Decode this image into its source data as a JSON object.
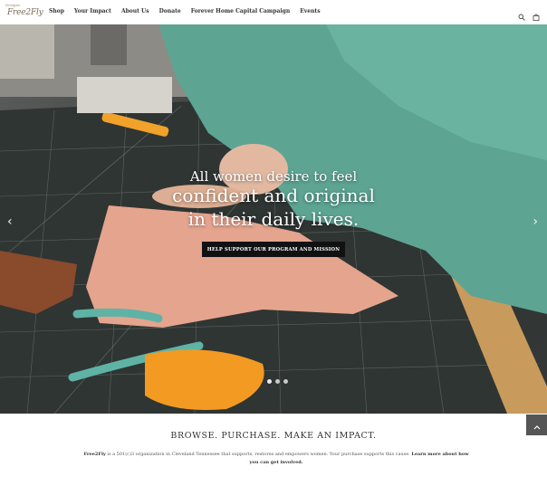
{
  "brand": {
    "tag": "Designs",
    "wordmark": "Free2Fly"
  },
  "nav": {
    "items": [
      {
        "label": "Shop"
      },
      {
        "label": "Your Impact"
      },
      {
        "label": "About Us"
      },
      {
        "label": "Donate"
      },
      {
        "label": "Forever Home Capital Campaign"
      },
      {
        "label": "Events"
      }
    ],
    "icons": [
      "search-icon",
      "bag-icon"
    ]
  },
  "hero": {
    "line1": "All women desire to feel",
    "line2": "confident and original",
    "line3": "in their daily lives.",
    "cta": "HELP SUPPORT OUR PROGRAM AND MISSION",
    "slides": 3,
    "active_slide": 1,
    "prev_icon": "chevron-left-icon",
    "next_icon": "chevron-right-icon"
  },
  "content": {
    "headline": "BROWSE. PURCHASE. MAKE AN IMPACT.",
    "brand_name": "Free2Fly",
    "body": " is a 501(c)3 organization in Cleveland Tennessee that supports, restores and empowers women. Your purchase supports this cause. ",
    "link": "Learn more about how you can get involved."
  },
  "scroll_top_icon": "chevron-up-icon",
  "colors": {
    "cta_bg": "#111111",
    "brand": "#7b6a55",
    "scroll_top_bg": "#555555"
  }
}
